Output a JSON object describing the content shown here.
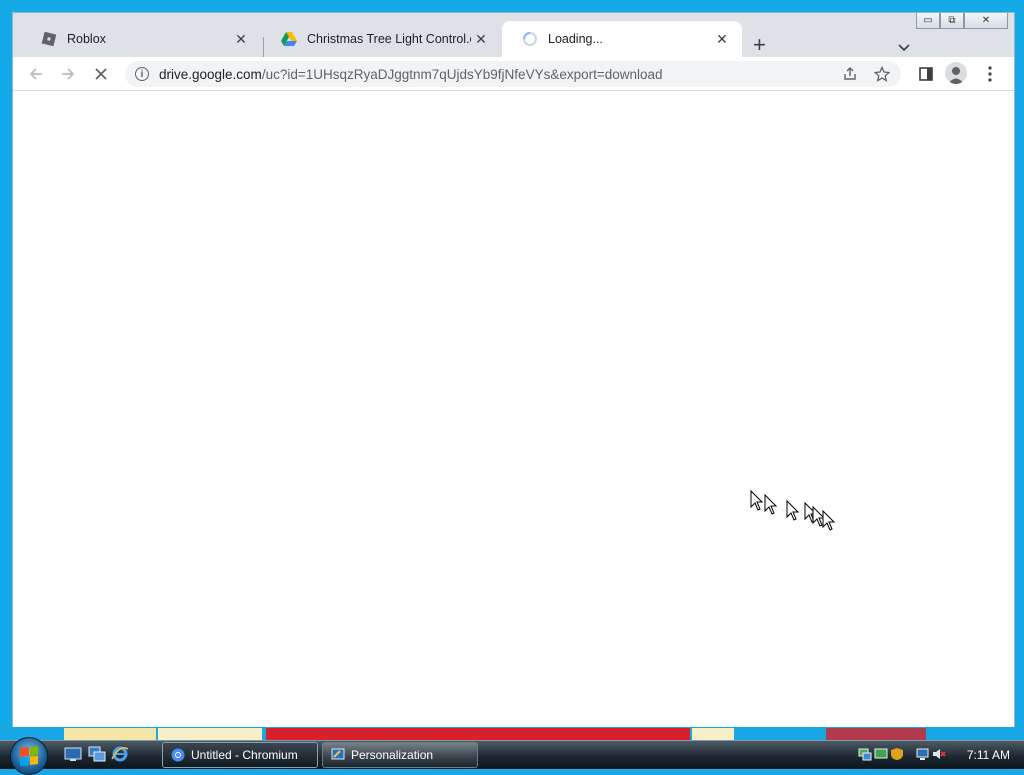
{
  "browser": {
    "tabs": [
      {
        "title": "Roblox",
        "favicon": "roblox-icon",
        "active": false
      },
      {
        "title": "Christmas Tree Light Control.exe",
        "favicon": "google-drive-icon",
        "active": false
      },
      {
        "title": "Loading...",
        "favicon": "loading-spinner-icon",
        "active": true
      }
    ],
    "new_tab_label": "+",
    "caption": {
      "minimize": "▭",
      "restore": "⧉",
      "close": "✕"
    },
    "toolbar": {
      "back_icon": "back-arrow-icon",
      "forward_icon": "forward-arrow-icon",
      "stop_icon": "stop-loading-icon",
      "url_host": "drive.google.com",
      "url_path": "/uc?id=1UHsqzRyaDJggtnm7qUjdsYb9fjNfeVYs&export=download"
    }
  },
  "taskbar": {
    "buttons": [
      {
        "label": "Untitled - Chromium",
        "icon": "chromium-icon",
        "active": true
      },
      {
        "label": "Personalization",
        "icon": "personalization-icon",
        "active": false
      }
    ],
    "clock": "7:11 AM"
  },
  "colors": {
    "desktop": "#16a9e8",
    "tab_strip": "#dee1e6",
    "taskbar": "#1d2832"
  }
}
